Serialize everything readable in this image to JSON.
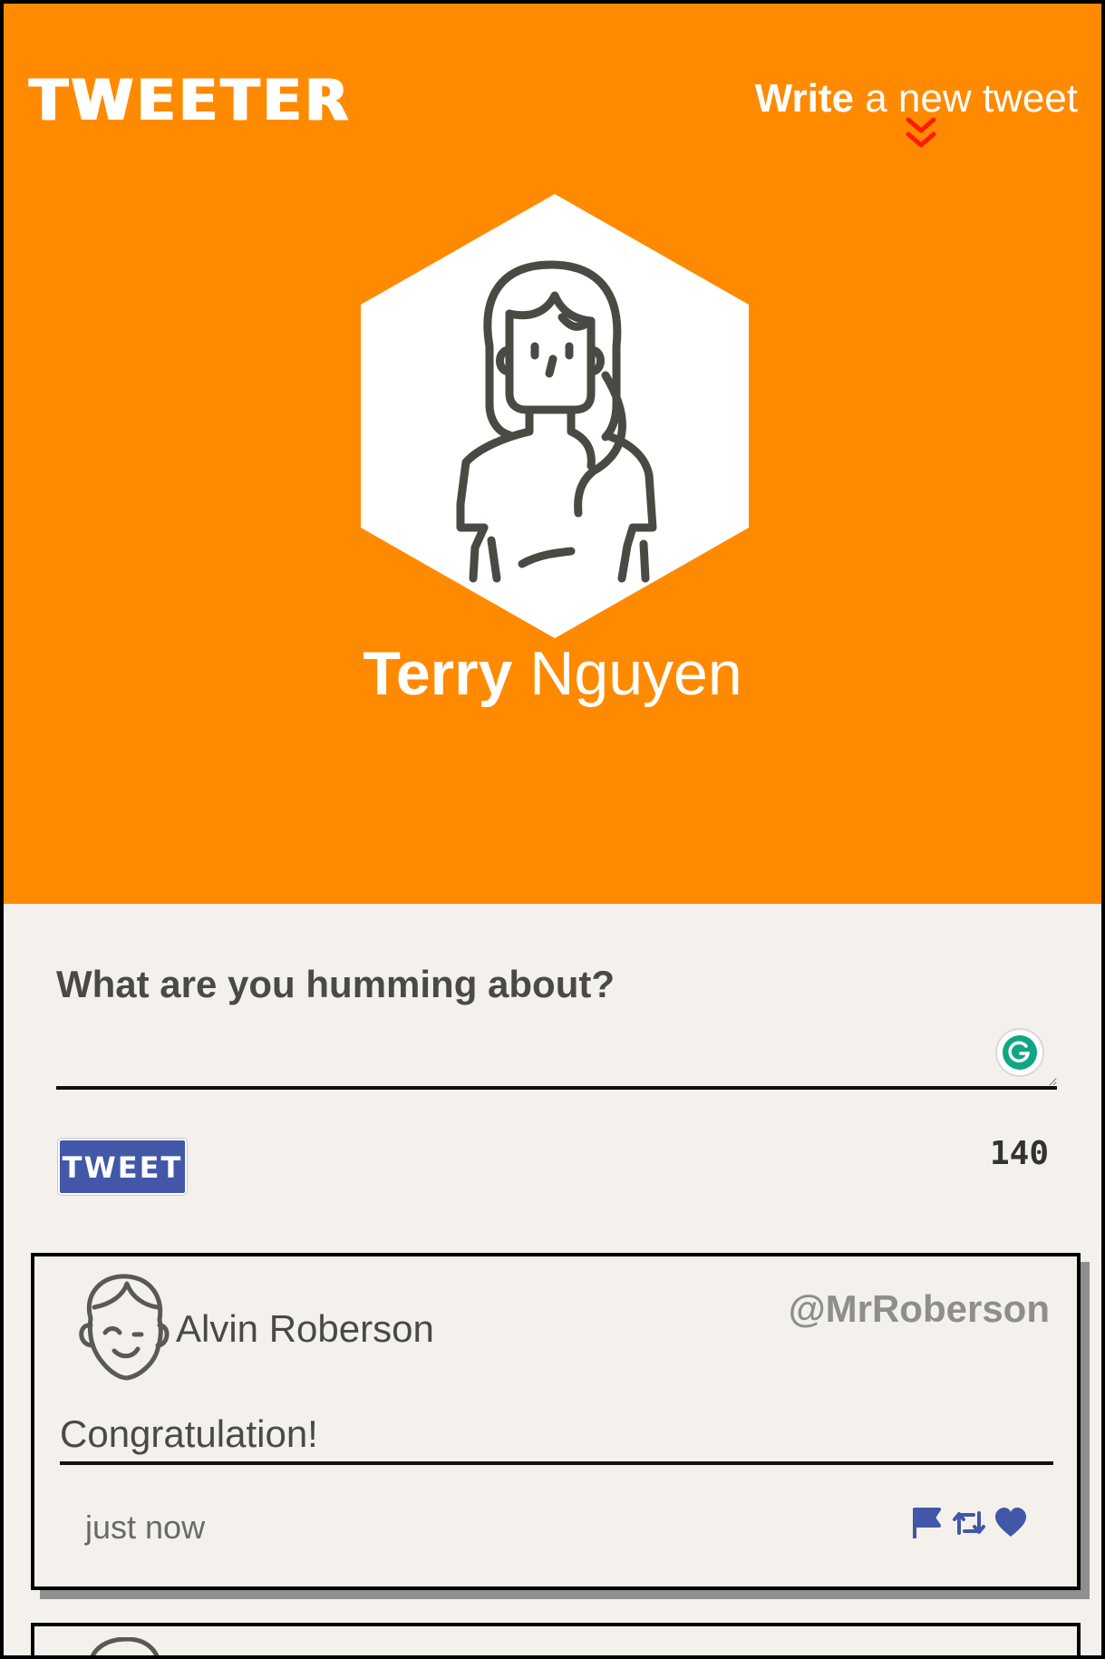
{
  "colors": {
    "header_bg": "#ff8a00",
    "body_bg": "#f4f1ed",
    "accent_blue": "#4257a8",
    "chevron_red": "#ff1a00"
  },
  "header": {
    "brand": "TWEETER",
    "write_bold": "Write",
    "write_rest": " a new tweet",
    "chevron_icon": "double-chevron-down-icon"
  },
  "profile": {
    "first_name": "Terry",
    "last_name": " Nguyen",
    "avatar_icon": "woman-avatar-icon"
  },
  "composer": {
    "label": "What are you humming about?",
    "value": "",
    "placeholder": "",
    "button_label": "TWEET",
    "counter": "140",
    "assistant_icon": "grammarly-icon"
  },
  "tweets": [
    {
      "name": "Alvin Roberson",
      "handle": "@MrRoberson",
      "content": "Congratulation!",
      "time": "just now",
      "avatar_icon": "man-avatar-icon",
      "actions": [
        "flag-icon",
        "retweet-icon",
        "heart-icon"
      ]
    }
  ]
}
